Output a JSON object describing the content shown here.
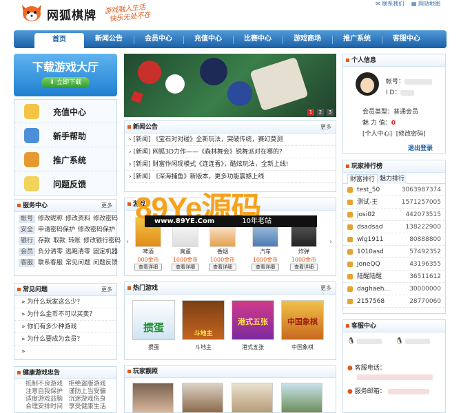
{
  "header": {
    "logo_text": "网狐棋牌",
    "slogan_line1": "游戏融入生活",
    "slogan_line2": "快乐无处不在",
    "top_links": [
      "联系我们",
      "网站地图"
    ]
  },
  "nav": [
    "首页",
    "新闻公告",
    "会员中心",
    "充值中心",
    "比赛中心",
    "游戏商场",
    "推广系统",
    "客服中心"
  ],
  "download": {
    "title": "下载游戏大厅",
    "button": "立即下载"
  },
  "quick_links": [
    "充值中心",
    "新手帮助",
    "推广系统",
    "问题反馈"
  ],
  "service": {
    "title": "服务中心",
    "more": "更多",
    "rows": [
      {
        "tag": "帐号",
        "links": [
          "修改昵称",
          "修改资料",
          "修改密码"
        ]
      },
      {
        "tag": "安全",
        "links": [
          "申请密码保护",
          "修改密码保护"
        ]
      },
      {
        "tag": "银行",
        "links": [
          "存款",
          "取款",
          "转账",
          "修改银行密码"
        ]
      },
      {
        "tag": "会员",
        "links": [
          "负分清零",
          "逃跑清零",
          "固定机器"
        ]
      },
      {
        "tag": "客服",
        "links": [
          "联系客服",
          "常见问题",
          "问题反馈"
        ]
      }
    ]
  },
  "faq": {
    "title": "常见问题",
    "more": "更多",
    "items": [
      "为什么玩家这么少？",
      "为什么金币不可以买卖？",
      "你们有多少种游戏",
      "为什么要成为会员？"
    ]
  },
  "health": {
    "title": "健康游戏忠告",
    "lines": [
      [
        "抵制不良游戏",
        "拒绝盗版游戏"
      ],
      [
        "注意自我保护",
        "谨防上当受骗"
      ],
      [
        "适度游戏益脑",
        "沉迷游戏伤身"
      ],
      [
        "合理安排时间",
        "享受健康生活"
      ]
    ]
  },
  "news": {
    "title": "新闻公告",
    "more": "更多",
    "items": [
      "[新闻] 《宝石对对碰》全新玩法，突破传统，赛幻莫测",
      "[新闻] 网狐3D力作——《森林舞会》锐舞派对在哪的?",
      "[新闻] 财富作闲现模式《连连看》，酷炫玩法，全新上线!",
      "[新闻] 《深海捕鱼》新版本，更多功能震撼上线"
    ]
  },
  "banner_nums": [
    "1",
    "2",
    "3"
  ],
  "mall": {
    "title": "游戏",
    "items": [
      {
        "name": "啤酒",
        "price": "000金币",
        "btn": "查看详细"
      },
      {
        "name": "臭蛋",
        "price": "1000金币",
        "btn": "查看详细"
      },
      {
        "name": "香烟",
        "price": "1000金币",
        "btn": "查看详细"
      },
      {
        "name": "汽车",
        "price": "1000金币",
        "btn": "查看详细"
      },
      {
        "name": "炸弹",
        "price": "1000金币",
        "btn": "查看详细"
      }
    ]
  },
  "watermark": {
    "big": "89Ye源码",
    "url": "www.89YE.Com",
    "tag": "10年老站"
  },
  "hot": {
    "title": "热门游戏",
    "more": "更多",
    "games": [
      "掼蛋",
      "斗地主",
      "港式五张",
      "中国象棋"
    ],
    "game_art": [
      "掼蛋",
      "斗地主",
      "港式五张",
      "中国象棋"
    ]
  },
  "show": {
    "title": "玩家靓照"
  },
  "user": {
    "title": "个人信息",
    "account_label": "帐号：",
    "id_label": "I D：",
    "member_type": "会员类型：普通会员",
    "charm": "魅 力 值：",
    "charm_val": "0",
    "links": [
      "[个人中心]",
      "[修改密码]"
    ],
    "logout": "退出登录"
  },
  "ranking": {
    "title": "玩家排行榜",
    "tabs": [
      "财富排行",
      "魅力排行"
    ],
    "rows": [
      {
        "name": "test_50",
        "value": "3063987374"
      },
      {
        "name": "测试-王",
        "value": "1571257005"
      },
      {
        "name": "josi02",
        "value": "442073515"
      },
      {
        "name": "dsadsad",
        "value": "138222900"
      },
      {
        "name": "wlg1911",
        "value": "80888800"
      },
      {
        "name": "1010asd",
        "value": "57492352"
      },
      {
        "name": "JoneQQ",
        "value": "43196355"
      },
      {
        "name": "陆醒陆醒",
        "value": "36511612"
      },
      {
        "name": "daghaeh...",
        "value": "30000000"
      },
      {
        "name": "2157568",
        "value": "28770060"
      }
    ]
  },
  "kefu": {
    "title": "客服中心",
    "phone_label": "客服电话：",
    "mail_label": "服务邮箱："
  },
  "colors": {
    "nav": "#1a5fa6",
    "accent": "#e05a1a",
    "watermark": "#f7a21b"
  }
}
